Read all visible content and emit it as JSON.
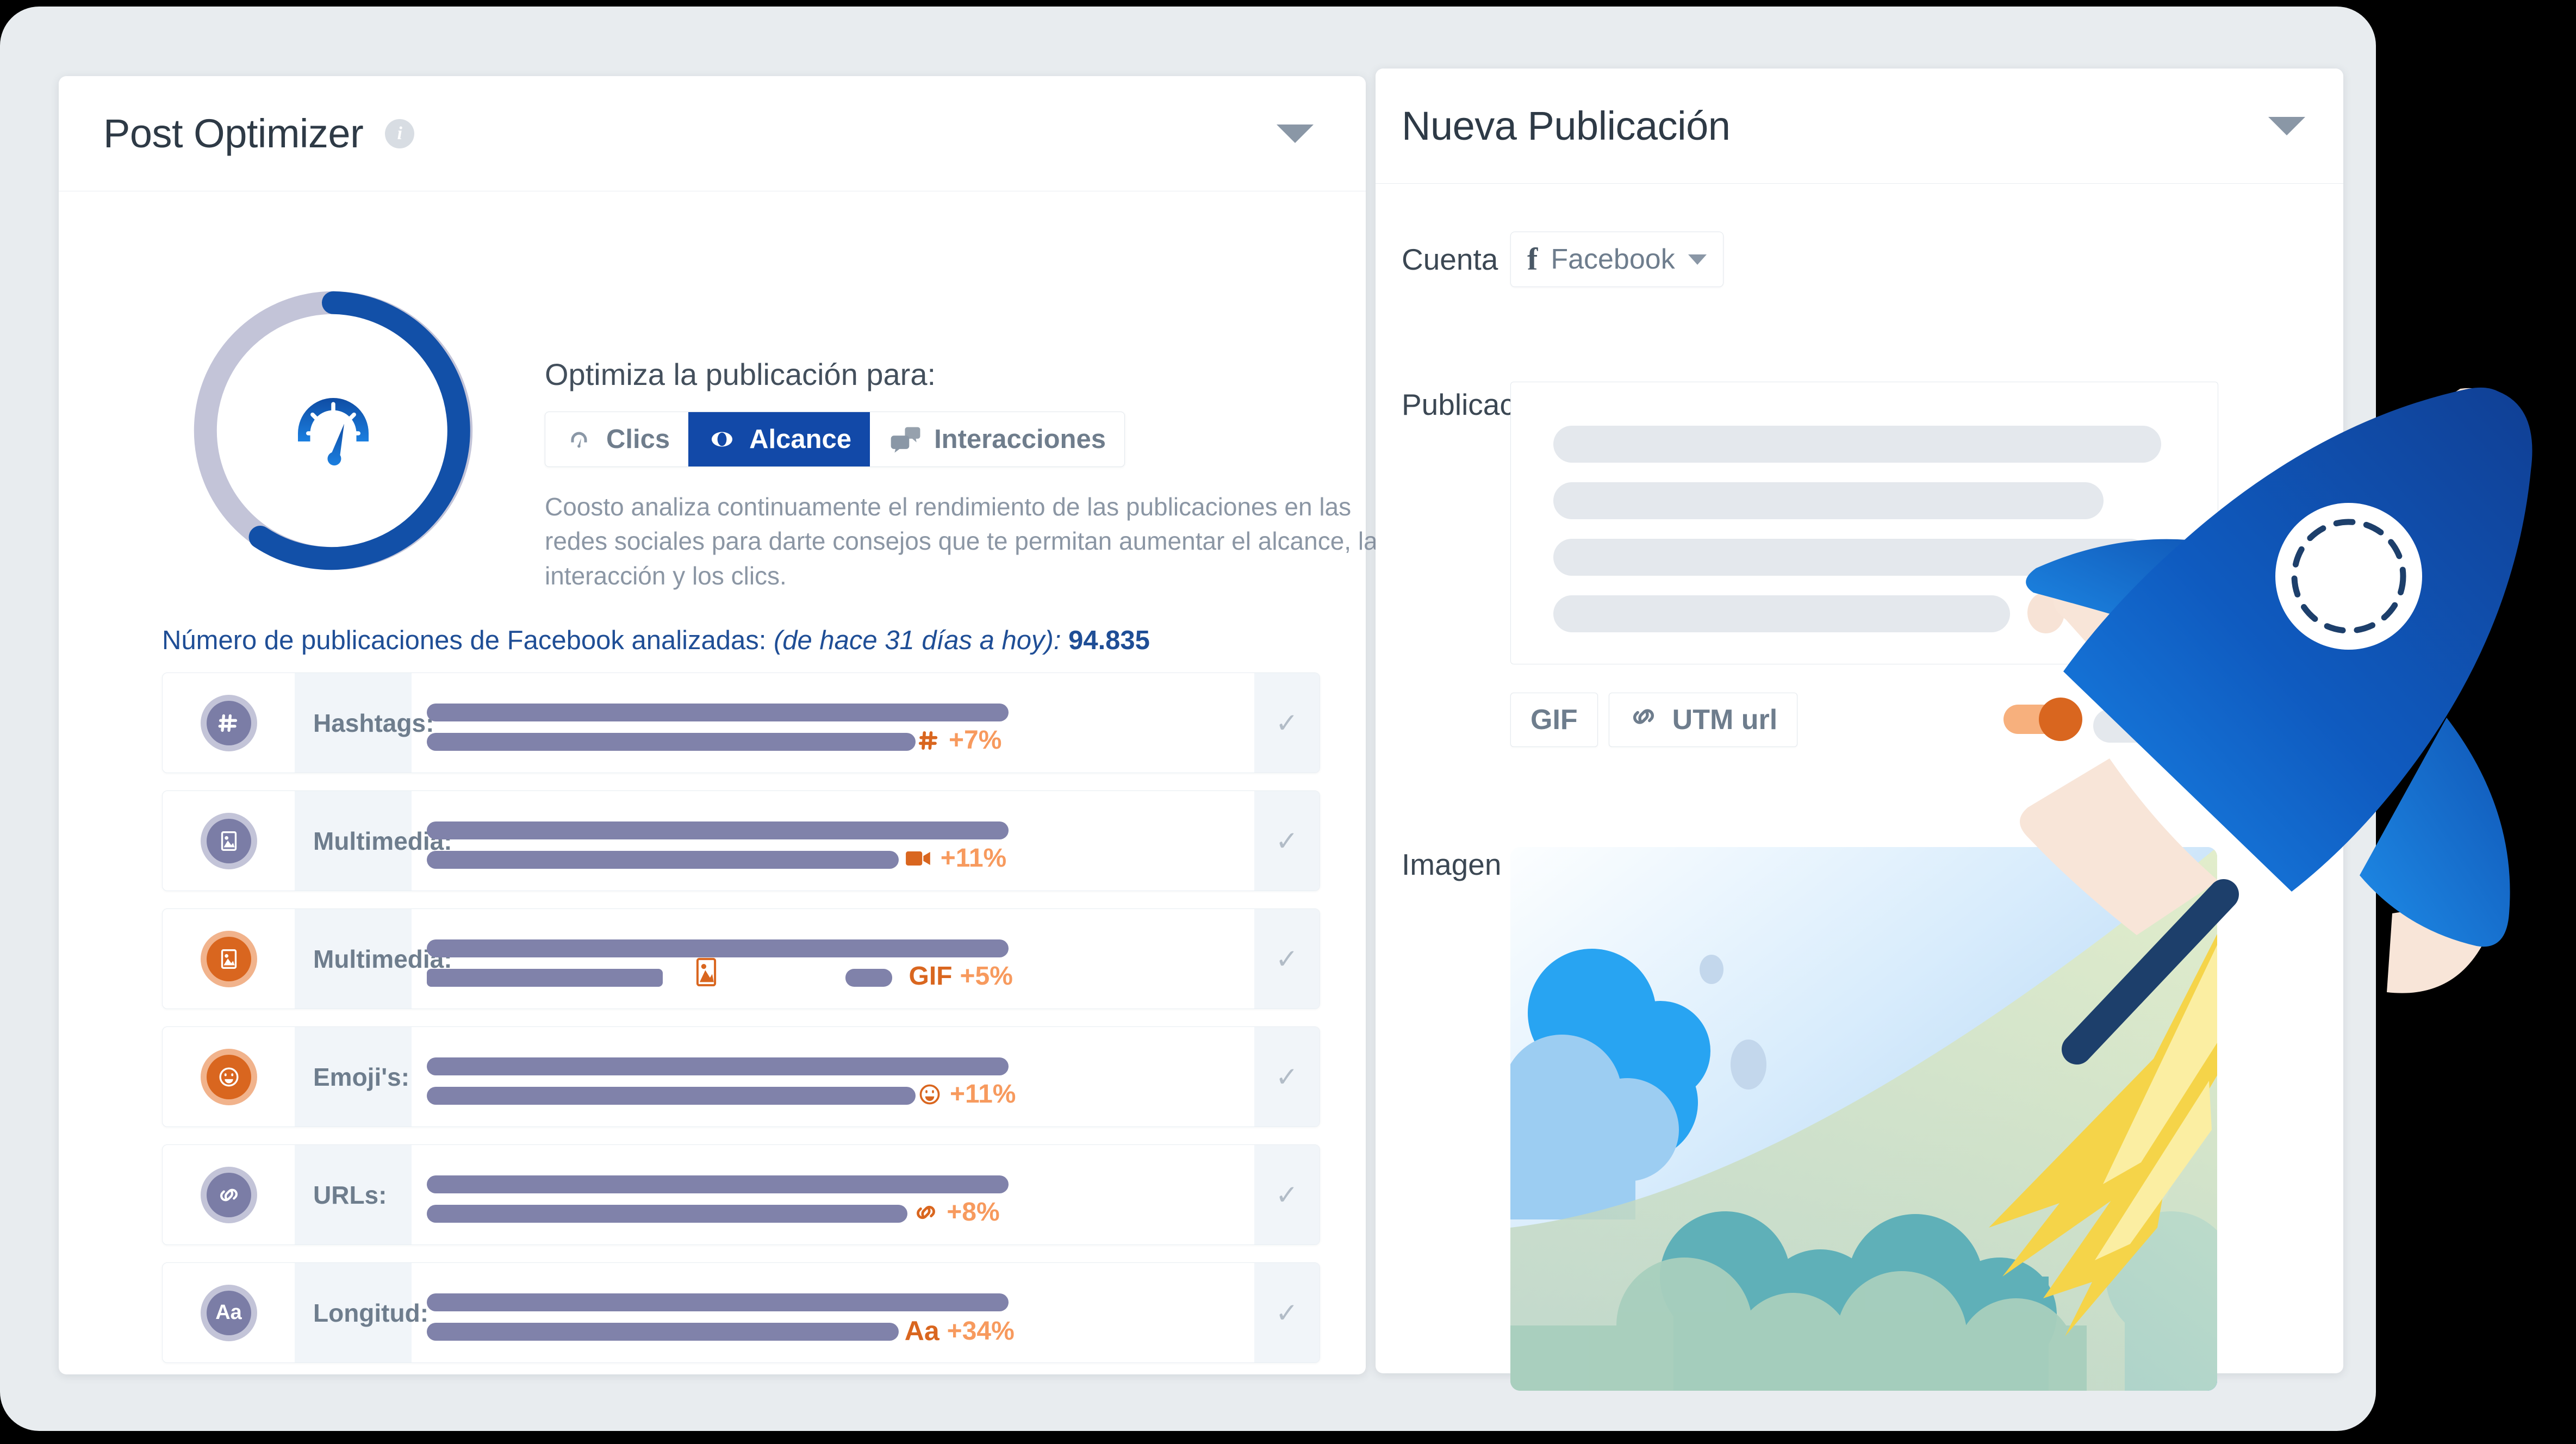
{
  "left_panel": {
    "title": "Post Optimizer",
    "info_icon": "info-icon",
    "collapse_icon": "chevron-down-icon",
    "optimize": {
      "title": "Optimiza la publicación para:",
      "tabs": [
        {
          "label": "Clics",
          "icon": "speedometer-icon",
          "active": false
        },
        {
          "label": "Alcance",
          "icon": "eye-icon",
          "active": true
        },
        {
          "label": "Interacciones",
          "icon": "comments-icon",
          "active": false
        }
      ],
      "description": "Coosto analiza continuamente el rendimiento de las publicaciones en las redes sociales para darte consejos que te permitan aumentar el alcance, la interacción y los clics."
    },
    "analysis": {
      "prefix": "Número de publicaciones de Facebook analizadas:",
      "range": "(de hace 31 días a hoy):",
      "count": "94.835"
    },
    "metrics": [
      {
        "label": "Hashtags:",
        "icon": "hashtag-icon",
        "badge_color": "#7b7da6",
        "badge_ring": "#c3c4d8",
        "pct": "+7%",
        "pct_icon": "hashtag-icon",
        "top_bar": 69,
        "bottom_bar": 58,
        "extra": null
      },
      {
        "label": "Multimedia:",
        "icon": "image-icon",
        "badge_color": "#7b7da6",
        "badge_ring": "#c3c4d8",
        "pct": "+11%",
        "pct_icon": "video-icon",
        "top_bar": 69,
        "bottom_bar": 56,
        "extra": null
      },
      {
        "label": "Multimedia:",
        "icon": "image-icon",
        "badge_color": "#d9661f",
        "badge_ring": "#f1b38c",
        "pct": "+5%",
        "pct_icon": "gif-text",
        "top_bar": 69,
        "bottom_bar": 28,
        "extra": "image-icon"
      },
      {
        "label": "Emoji's:",
        "icon": "smile-icon",
        "badge_color": "#d9661f",
        "badge_ring": "#f1b38c",
        "pct": "+11%",
        "pct_icon": "smile-icon",
        "top_bar": 69,
        "bottom_bar": 58,
        "extra": null
      },
      {
        "label": "URLs:",
        "icon": "link-icon",
        "badge_color": "#7b7da6",
        "badge_ring": "#c3c4d8",
        "pct": "+8%",
        "pct_icon": "link-icon",
        "top_bar": 69,
        "bottom_bar": 57,
        "extra": null
      },
      {
        "label": "Longitud:",
        "icon": "text-size-icon",
        "badge_color": "#7b7da6",
        "badge_ring": "#c3c4d8",
        "pct": "+34%",
        "pct_icon": "text-size-icon",
        "top_bar": 69,
        "bottom_bar": 56,
        "extra": null
      }
    ],
    "row_check_glyph": "✓",
    "gauge": {
      "percent": 55,
      "track_color": "#c3c4d8",
      "arc_color": "#1250a8",
      "icon": "speedometer-icon"
    }
  },
  "right_panel": {
    "title": "Nueva Publicación",
    "collapse_icon": "chevron-down-icon",
    "account": {
      "label": "Cuenta",
      "value": "Facebook",
      "icon": "facebook-f-icon",
      "chevron": "chevron-down-icon"
    },
    "post": {
      "label": "Publicación",
      "placeholder_lines": 4,
      "emoji_button": "smile-icon"
    },
    "tools": [
      {
        "label": "GIF",
        "icon": null
      },
      {
        "label": "UTM url",
        "icon": "link-icon"
      }
    ],
    "toggle": {
      "state": "on",
      "color": "#d9661f"
    },
    "image": {
      "label": "Imagen",
      "illustration": "clouds-sky-illustration"
    }
  },
  "decoration": {
    "rocket": "rocket-illustration"
  },
  "colors": {
    "accent_blue": "#1250a8",
    "accent_orange": "#d9661f",
    "bar_purple": "#8082aa",
    "frame_grey": "#e8ecef",
    "text_dark": "#2e3a46",
    "text_muted": "#8b96a4",
    "link_blue": "#1f4e96"
  }
}
